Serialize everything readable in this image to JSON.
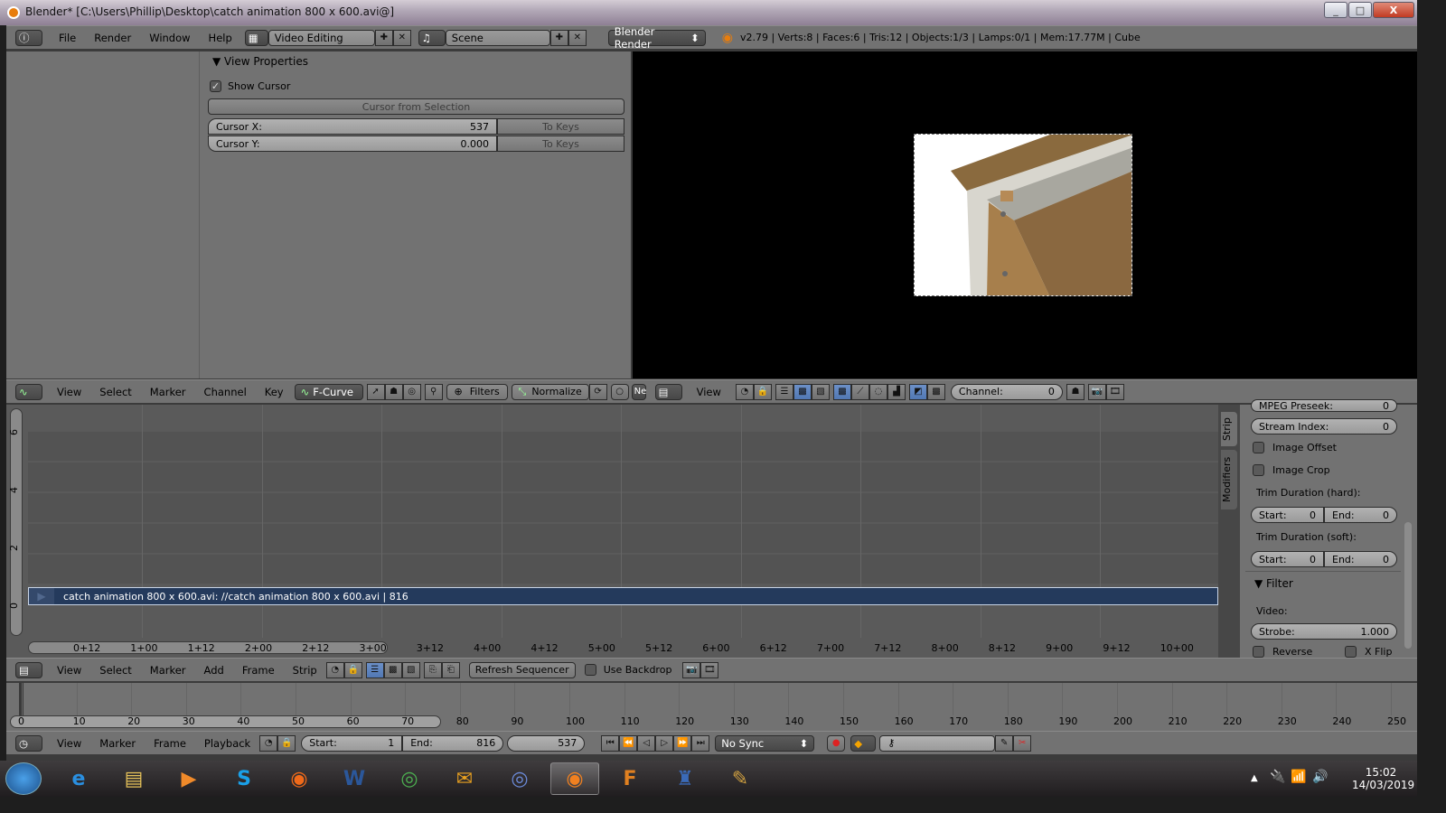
{
  "window": {
    "title": "Blender* [C:\\Users\\Phillip\\Desktop\\catch animation 800 x 600.avi@]",
    "minimize": "_",
    "maximize": "□",
    "close": "X"
  },
  "info_header": {
    "menus": [
      "File",
      "Render",
      "Window",
      "Help"
    ],
    "screen_layout": "Video Editing",
    "scene": "Scene",
    "render_engine": "Blender Render",
    "stats": "v2.79 | Verts:8 | Faces:6 | Tris:12 | Objects:1/3 | Lamps:0/1 | Mem:17.77M | Cube"
  },
  "view_properties": {
    "panel_title": "View Properties",
    "show_cursor_label": "Show Cursor",
    "show_cursor_checked": true,
    "cursor_from_selection": "Cursor from Selection",
    "cursor_x_label": "Cursor X:",
    "cursor_x_value": "537",
    "cursor_y_label": "Cursor Y:",
    "cursor_y_value": "0.000",
    "to_keys": "To Keys"
  },
  "graph_header": {
    "menus": [
      "View",
      "Select",
      "Marker",
      "Channel",
      "Key"
    ],
    "mode": "F-Curve",
    "filters": "Filters",
    "normalize": "Normalize",
    "truncated": "Ne"
  },
  "preview_header": {
    "view": "View",
    "channel_label": "Channel:",
    "channel_value": "0"
  },
  "sequencer": {
    "y_ticks": [
      "6",
      "4",
      "2",
      "0"
    ],
    "x_ticks": [
      "0+12",
      "1+00",
      "1+12",
      "2+00",
      "2+12",
      "3+00",
      "3+12",
      "4+00",
      "4+12",
      "5+00",
      "5+12",
      "6+00",
      "6+12",
      "7+00",
      "7+12",
      "8+00",
      "8+12",
      "9+00",
      "9+12",
      "10+00"
    ],
    "strip_label": "catch animation 800 x 600.avi: //catch animation 800 x 600.avi | 816",
    "strip_color": "#243a5c"
  },
  "strip_panel": {
    "tabs": [
      "Strip",
      "Modifiers"
    ],
    "mpeg_preseek_label": "MPEG Preseek:",
    "mpeg_preseek_value": "0",
    "stream_index_label": "Stream Index:",
    "stream_index_value": "0",
    "image_offset": "Image Offset",
    "image_crop": "Image Crop",
    "trim_hard": "Trim Duration (hard):",
    "trim_soft": "Trim Duration (soft):",
    "start_label": "Start:",
    "end_label": "End:",
    "hard_start": "0",
    "hard_end": "0",
    "soft_start": "0",
    "soft_end": "0",
    "filter_title": "Filter",
    "video_label": "Video:",
    "strobe_label": "Strobe:",
    "strobe_value": "1.000",
    "reverse": "Reverse",
    "xflip": "X Flip"
  },
  "seq_header": {
    "menus": [
      "View",
      "Select",
      "Marker",
      "Add",
      "Frame",
      "Strip"
    ],
    "refresh": "Refresh Sequencer",
    "use_backdrop": "Use Backdrop"
  },
  "timeline": {
    "ticks": [
      "0",
      "10",
      "20",
      "30",
      "40",
      "50",
      "60",
      "70",
      "80",
      "90",
      "100",
      "110",
      "120",
      "130",
      "140",
      "150",
      "160",
      "170",
      "180",
      "190",
      "200",
      "210",
      "220",
      "230",
      "240",
      "250"
    ],
    "menus": [
      "View",
      "Marker",
      "Frame",
      "Playback"
    ],
    "start_label": "Start:",
    "start_value": "1",
    "end_label": "End:",
    "end_value": "816",
    "current_frame": "537",
    "sync": "No Sync"
  },
  "taskbar": {
    "apps": [
      "Start",
      "Internet Explorer",
      "File Explorer",
      "Media Player",
      "Skype",
      "Firefox",
      "Word",
      "Chrome",
      "Outlook",
      "Chromium",
      "Blender",
      "FL Studio",
      "Network",
      "Paint"
    ],
    "time": "15:02",
    "date": "14/03/2019"
  }
}
